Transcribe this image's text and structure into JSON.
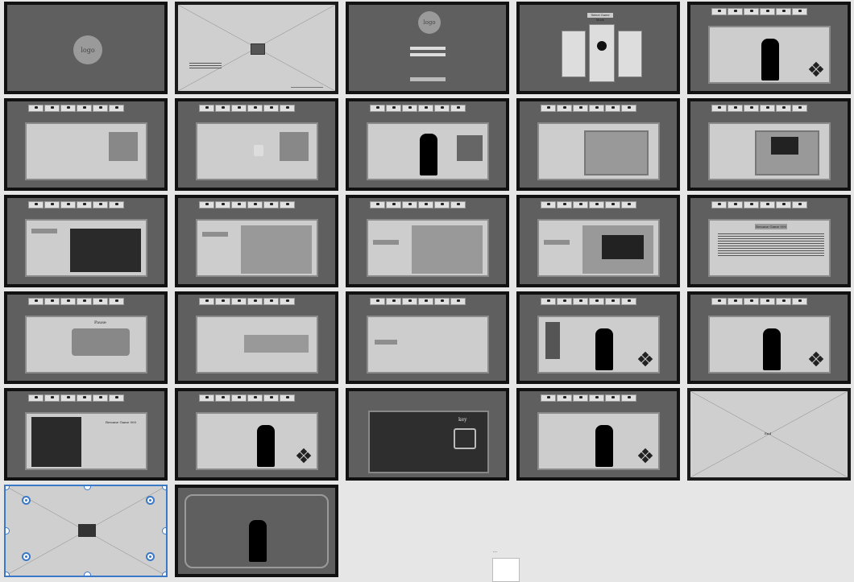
{
  "boards": {
    "b1": {
      "logo": "logo"
    },
    "b3": {
      "logo": "logo"
    },
    "b4": {
      "title": "Select Game Mode"
    },
    "b15": {
      "title": "Resume Game 000"
    },
    "b17": {
      "title": "Pause"
    },
    "b24": {
      "title": "Resume Game 000"
    },
    "b25": {
      "title": "key"
    },
    "b27": {
      "label": "End"
    }
  },
  "toolbar_icons": [
    "pet-icon",
    "character-icon",
    "item-icon",
    "play-icon",
    "multiplayer-icon",
    "settings-icon"
  ],
  "ghost_note": "..."
}
